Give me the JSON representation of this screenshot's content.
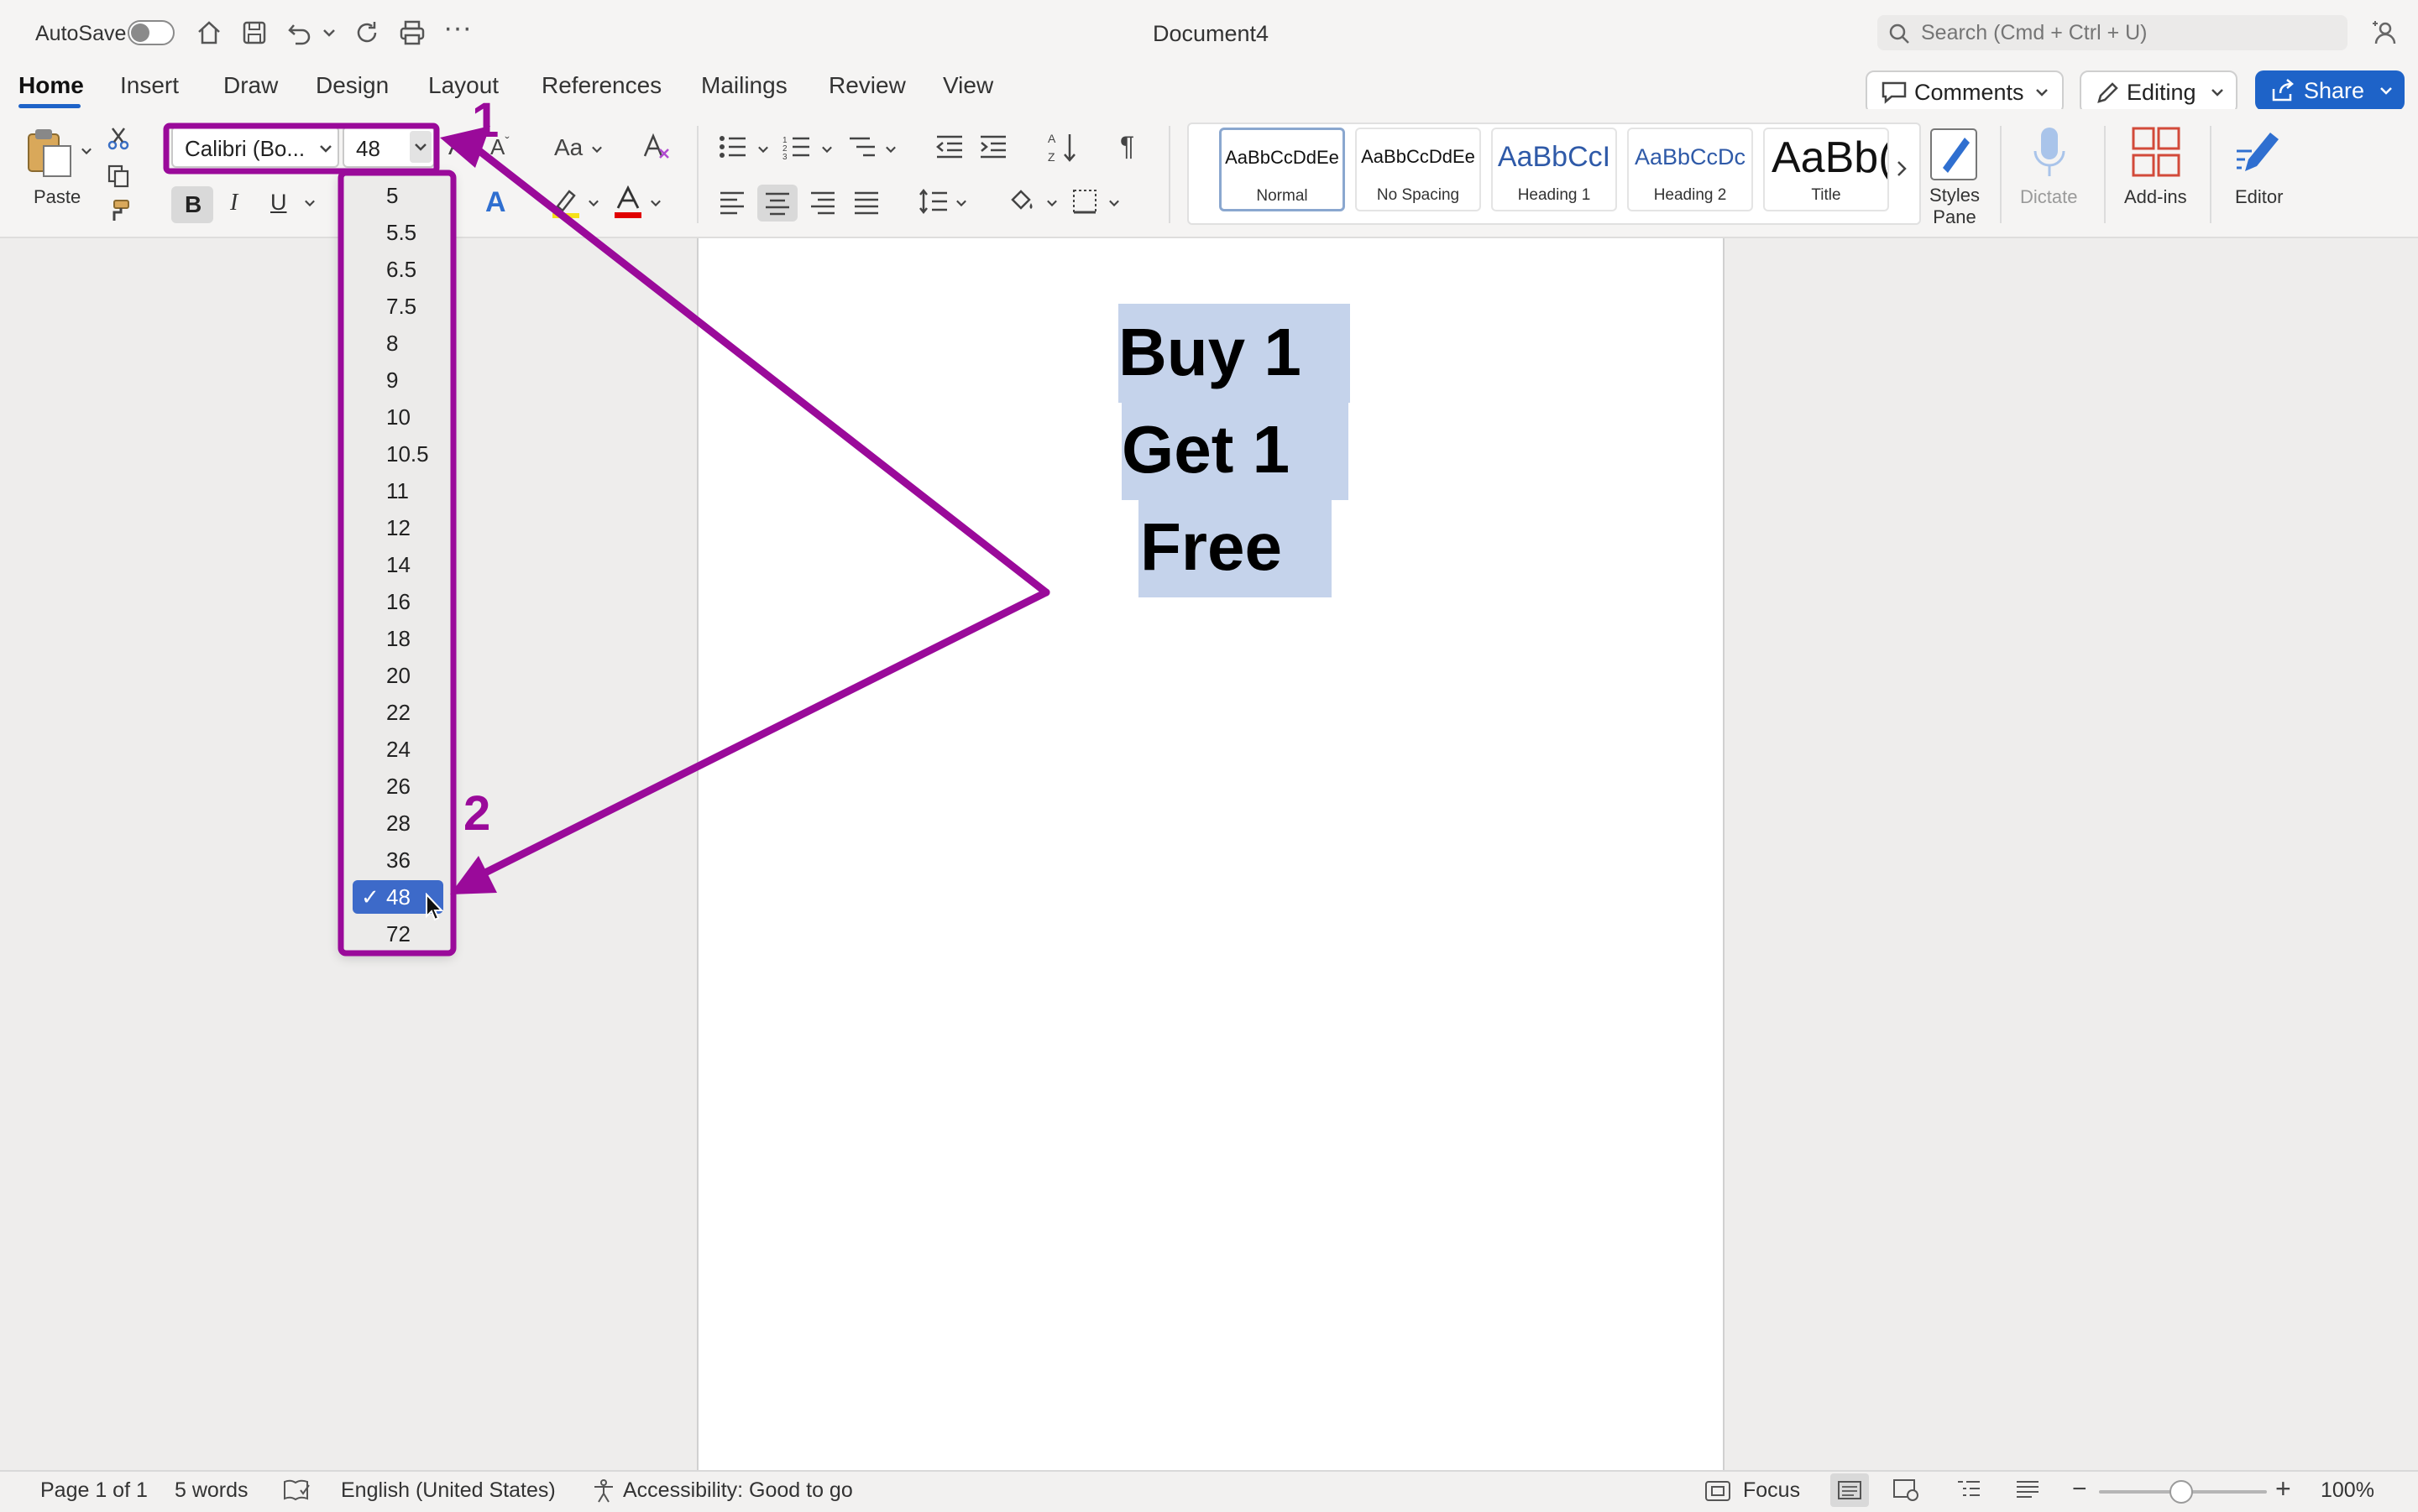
{
  "window": {
    "title": "Document4",
    "autosave_label": "AutoSave"
  },
  "search": {
    "placeholder": "Search (Cmd + Ctrl + U)"
  },
  "tabs": [
    "Home",
    "Insert",
    "Draw",
    "Design",
    "Layout",
    "References",
    "Mailings",
    "Review",
    "View"
  ],
  "header_buttons": {
    "comments": "Comments",
    "editing": "Editing",
    "share": "Share"
  },
  "ribbon": {
    "paste_label": "Paste",
    "font_name": "Calibri (Bo...",
    "font_size": "48",
    "styles": [
      {
        "sample": "AaBbCcDdEe",
        "name": "Normal"
      },
      {
        "sample": "AaBbCcDdEe",
        "name": "No Spacing"
      },
      {
        "sample": "AaBbCcI",
        "name": "Heading 1"
      },
      {
        "sample": "AaBbCcDc",
        "name": "Heading 2"
      },
      {
        "sample": "AaBb(",
        "name": "Title"
      }
    ],
    "styles_pane_label": "Styles Pane",
    "dictate_label": "Dictate",
    "addins_label": "Add-ins",
    "editor_label": "Editor"
  },
  "font_size_dropdown": {
    "options": [
      "5",
      "5.5",
      "6.5",
      "7.5",
      "8",
      "9",
      "10",
      "10.5",
      "11",
      "12",
      "14",
      "16",
      "18",
      "20",
      "22",
      "24",
      "26",
      "28",
      "36",
      "48",
      "72"
    ],
    "selected": "48"
  },
  "document": {
    "lines": [
      "Buy 1",
      "Get 1",
      "Free"
    ]
  },
  "annotations": {
    "step1": "1",
    "step2": "2",
    "color": "#9a0a9a"
  },
  "status_bar": {
    "page": "Page 1 of 1",
    "words": "5 words",
    "language": "English (United States)",
    "accessibility": "Accessibility: Good to go",
    "focus": "Focus",
    "zoom": "100%"
  },
  "colors": {
    "accent": "#1e63c8",
    "selection": "#c5d3eb",
    "annotation": "#9a0a9a",
    "font_color_bar": "#e00000",
    "highlight_bar": "#f5e11a"
  }
}
